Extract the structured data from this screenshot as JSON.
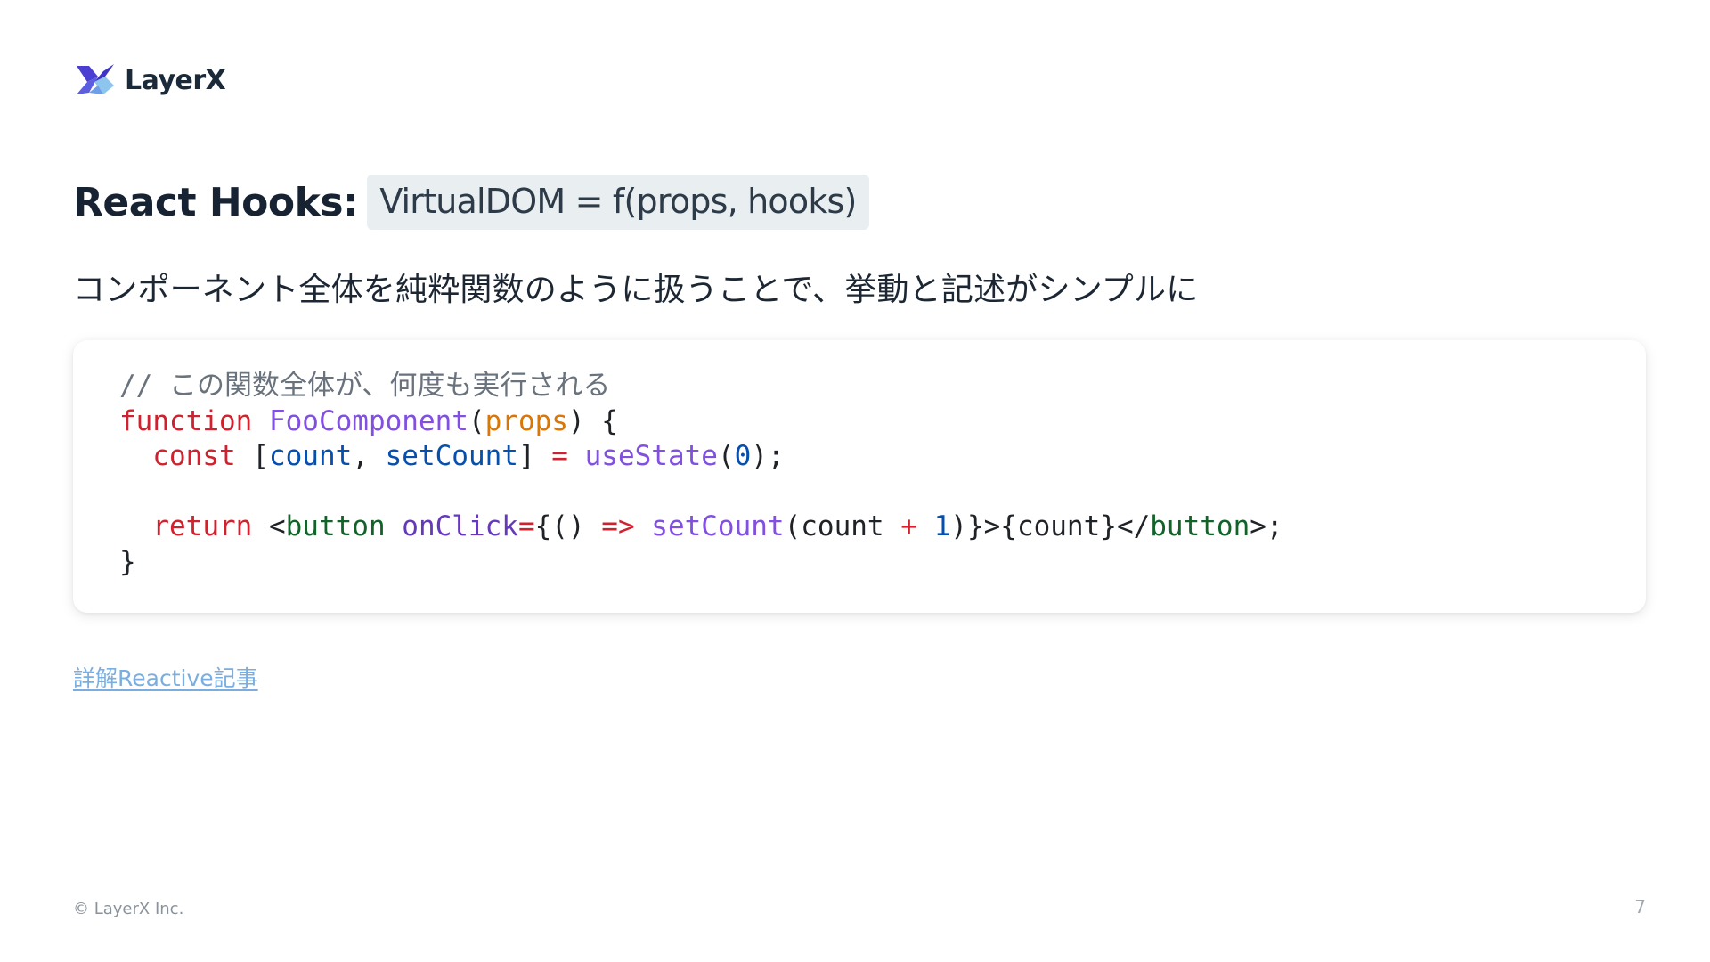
{
  "brand": {
    "name": "LayerX",
    "logo_icon": "layerx-logo-icon",
    "logo_colors": [
      "#4a3fd1",
      "#6d72e8",
      "#8ec5ee"
    ]
  },
  "slide": {
    "title_main": "React Hooks:",
    "title_code": "VirtualDOM = f(props, hooks)",
    "subtitle": "コンポーネント全体を純粋関数のように扱うことで、挙動と記述がシンプルに"
  },
  "code": {
    "comment": "// この関数全体が、何度も実行される",
    "kw_function": "function",
    "fn_name": "FooComponent",
    "param": "props",
    "kw_const": "const",
    "var_count": "count",
    "var_setCount": "setCount",
    "op_assign": "=",
    "fn_useState": "useState",
    "num_zero": "0",
    "kw_return": "return",
    "tag_button": "button",
    "attr_onClick": "onClick",
    "op_eq": "=",
    "op_arrow": "=>",
    "fn_setCount": "setCount",
    "expr_count": "count",
    "op_plus": "+",
    "num_one": "1",
    "jsx_count": "{count}",
    "colors": {
      "comment": "#6a737d",
      "keyword": "#cf222e",
      "function": "#8250df",
      "param": "#d97706",
      "variable": "#0550ae",
      "tag": "#116329"
    }
  },
  "link": {
    "label": "詳解Reactive記事",
    "color": "#7aaee0"
  },
  "footer": {
    "copyright": "© LayerX Inc.",
    "page_number": "7"
  }
}
